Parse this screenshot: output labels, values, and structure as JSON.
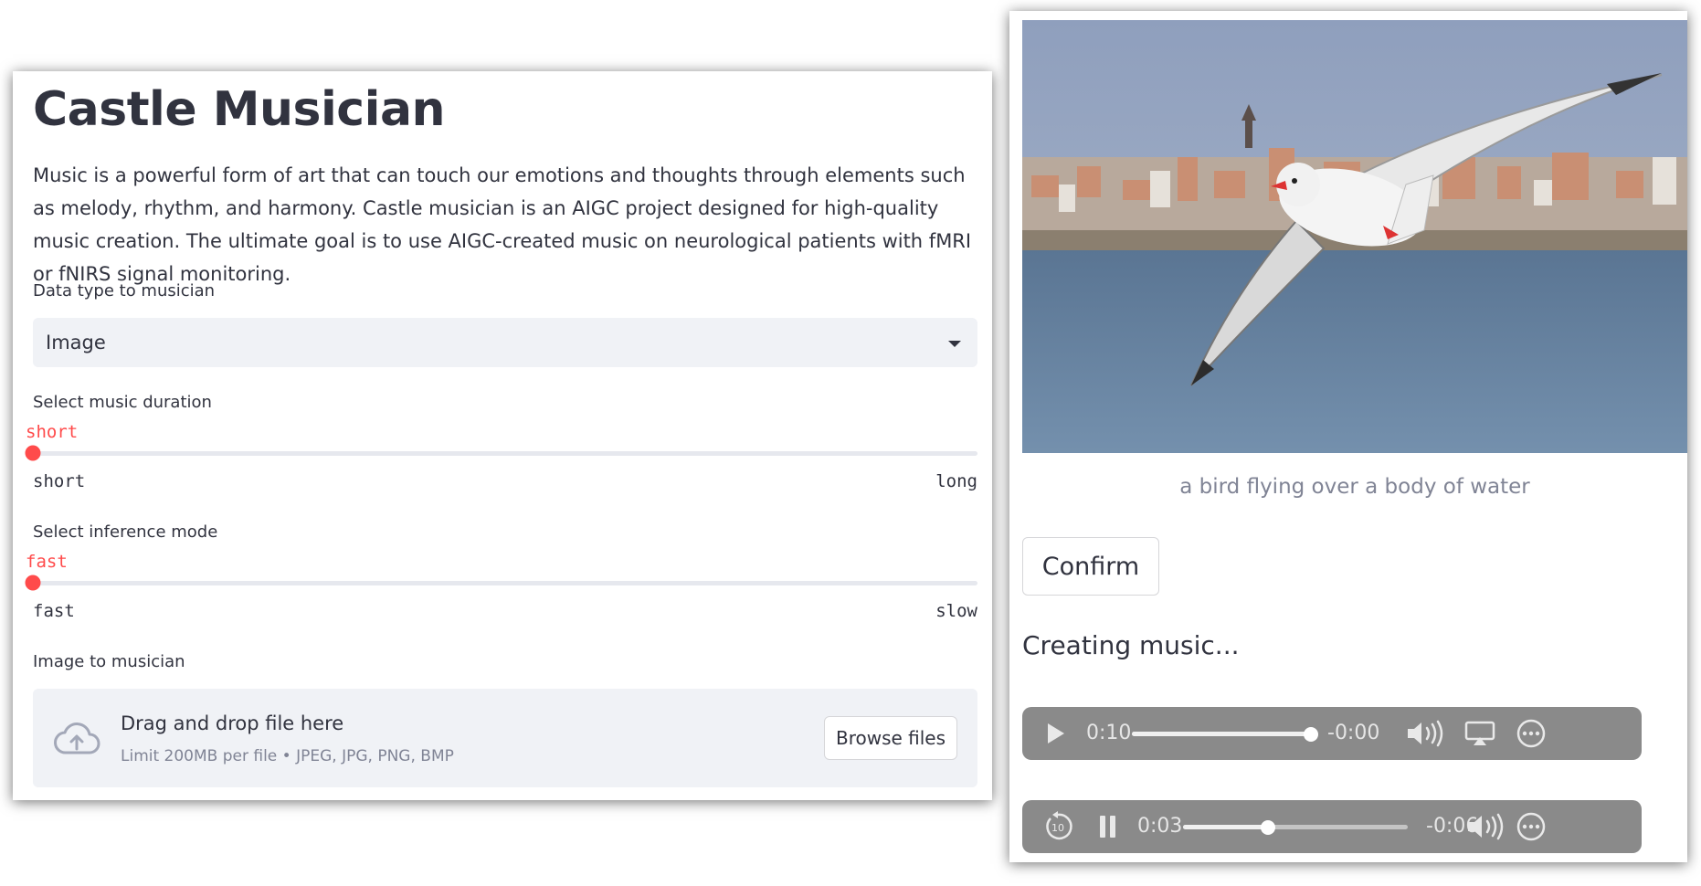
{
  "app": {
    "title": "Castle Musician",
    "description": "Music is a powerful form of art that can touch our emotions and thoughts through elements such as melody, rhythm, and harmony. Castle musician is an AIGC project designed for high-quality music creation. The ultimate goal is to use AIGC-created music on neurological patients with fMRI or fNIRS signal monitoring."
  },
  "data_type": {
    "label": "Data type to musician",
    "selected": "Image"
  },
  "duration_slider": {
    "label": "Select music duration",
    "value": "short",
    "min_label": "short",
    "max_label": "long",
    "position": 0
  },
  "inference_slider": {
    "label": "Select inference mode",
    "value": "fast",
    "min_label": "fast",
    "max_label": "slow",
    "position": 0
  },
  "uploader": {
    "label": "Image to musician",
    "title": "Drag and drop file here",
    "subtitle": "Limit 200MB per file • JPEG, JPG, PNG, BMP",
    "button": "Browse files"
  },
  "image_panel": {
    "caption": "a bird flying over a body of water",
    "confirm_button": "Confirm",
    "status": "Creating music..."
  },
  "player_1": {
    "elapsed": "0:10",
    "remaining": "-0:00",
    "progress": 1.0
  },
  "player_2": {
    "elapsed": "0:03",
    "remaining": "-0:06",
    "progress": 0.38
  },
  "colors": {
    "accent": "#ff4b4b",
    "panel_bg": "#f0f2f6",
    "text": "#31333f",
    "muted": "#808495",
    "player_bg": "#8a8a8a"
  },
  "icons": [
    "chevron-down-icon",
    "cloud-upload-icon",
    "play-icon",
    "pause-icon",
    "replay-10-icon",
    "volume-icon",
    "airplay-icon",
    "more-icon"
  ]
}
